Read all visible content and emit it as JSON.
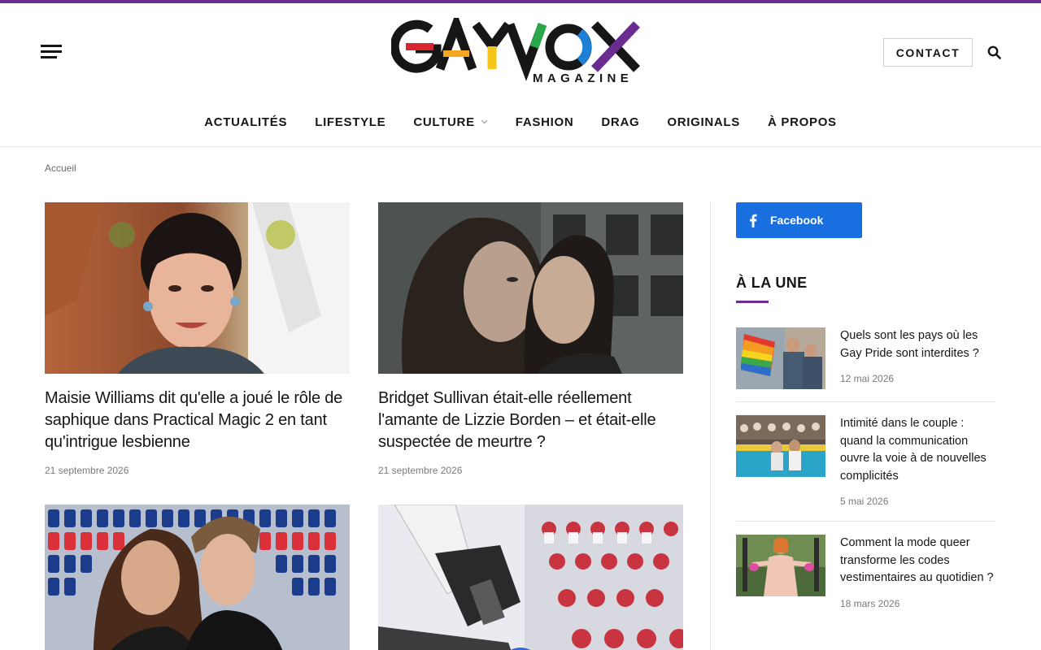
{
  "colors": {
    "accent_bar": "#6a2c91",
    "facebook": "#1a6fe0",
    "heading_underline": "#6a2c91"
  },
  "header": {
    "logo_text": "GAYVOX",
    "logo_tagline": "MAGAZINE",
    "contact_label": "CONTACT",
    "menu_icon": "hamburger-menu-icon",
    "search_icon": "search-icon"
  },
  "nav": {
    "items": [
      {
        "label": "ACTUALITÉS"
      },
      {
        "label": "LIFESTYLE"
      },
      {
        "label": "CULTURE",
        "has_dropdown": true
      },
      {
        "label": "FASHION"
      },
      {
        "label": "DRAG"
      },
      {
        "label": "ORIGINALS"
      },
      {
        "label": "À PROPOS"
      }
    ]
  },
  "breadcrumb": "Accueil",
  "articles": [
    {
      "title": "Maisie Williams dit qu'elle a joué le rôle de saphique dans Practical Magic 2 en tant qu'intrigue lesbienne",
      "date": "21 septembre 2026"
    },
    {
      "title": "Bridget Sullivan était-elle réellement l'amante de Lizzie Borden – et était-elle suspectée de meurtre ?",
      "date": "21 septembre 2026"
    },
    {
      "title": "",
      "date": ""
    },
    {
      "title": "",
      "date": ""
    }
  ],
  "sidebar": {
    "facebook_label": "Facebook",
    "heading": "À LA UNE",
    "items": [
      {
        "title": "Quels sont les pays où les Gay Pride sont interdites ?",
        "date": "12 mai 2026"
      },
      {
        "title": "Intimité dans le couple : quand la communication ouvre la voie à de nouvelles complicités",
        "date": "5 mai 2026"
      },
      {
        "title": "Comment la mode queer transforme les codes vestimentaires au quotidien ?",
        "date": "18 mars 2026"
      }
    ]
  }
}
